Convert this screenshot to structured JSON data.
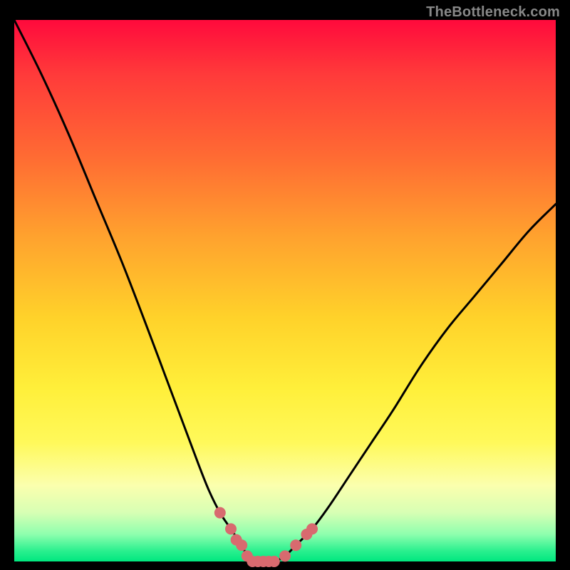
{
  "watermark": "TheBottleneck.com",
  "colors": {
    "background": "#000000",
    "curve_stroke": "#000000",
    "marker_fill": "#d86a6f",
    "watermark_text": "#888888"
  },
  "chart_data": {
    "type": "line",
    "title": "",
    "xlabel": "",
    "ylabel": "",
    "xlim": [
      0,
      100
    ],
    "ylim": [
      0,
      100
    ],
    "grid": false,
    "legend": false,
    "series": [
      {
        "name": "bottleneck-curve",
        "x": [
          0,
          5,
          10,
          15,
          20,
          25,
          28,
          31,
          34,
          36,
          38,
          40,
          42,
          43,
          44,
          45,
          46,
          48,
          50,
          52,
          55,
          58,
          62,
          66,
          70,
          75,
          80,
          85,
          90,
          95,
          100
        ],
        "y": [
          100,
          90,
          79,
          67,
          55,
          42,
          34,
          26,
          18,
          13,
          9,
          6,
          3,
          1,
          0,
          0,
          0,
          0,
          1,
          3,
          6,
          10,
          16,
          22,
          28,
          36,
          43,
          49,
          55,
          61,
          66
        ]
      }
    ],
    "markers": {
      "name": "highlight-dots",
      "color": "#d86a6f",
      "points": [
        {
          "x": 38,
          "y": 9
        },
        {
          "x": 40,
          "y": 6
        },
        {
          "x": 41,
          "y": 4
        },
        {
          "x": 42,
          "y": 3
        },
        {
          "x": 43,
          "y": 1
        },
        {
          "x": 44,
          "y": 0
        },
        {
          "x": 45,
          "y": 0
        },
        {
          "x": 46,
          "y": 0
        },
        {
          "x": 47,
          "y": 0
        },
        {
          "x": 48,
          "y": 0
        },
        {
          "x": 50,
          "y": 1
        },
        {
          "x": 52,
          "y": 3
        },
        {
          "x": 54,
          "y": 5
        },
        {
          "x": 55,
          "y": 6
        }
      ]
    }
  }
}
